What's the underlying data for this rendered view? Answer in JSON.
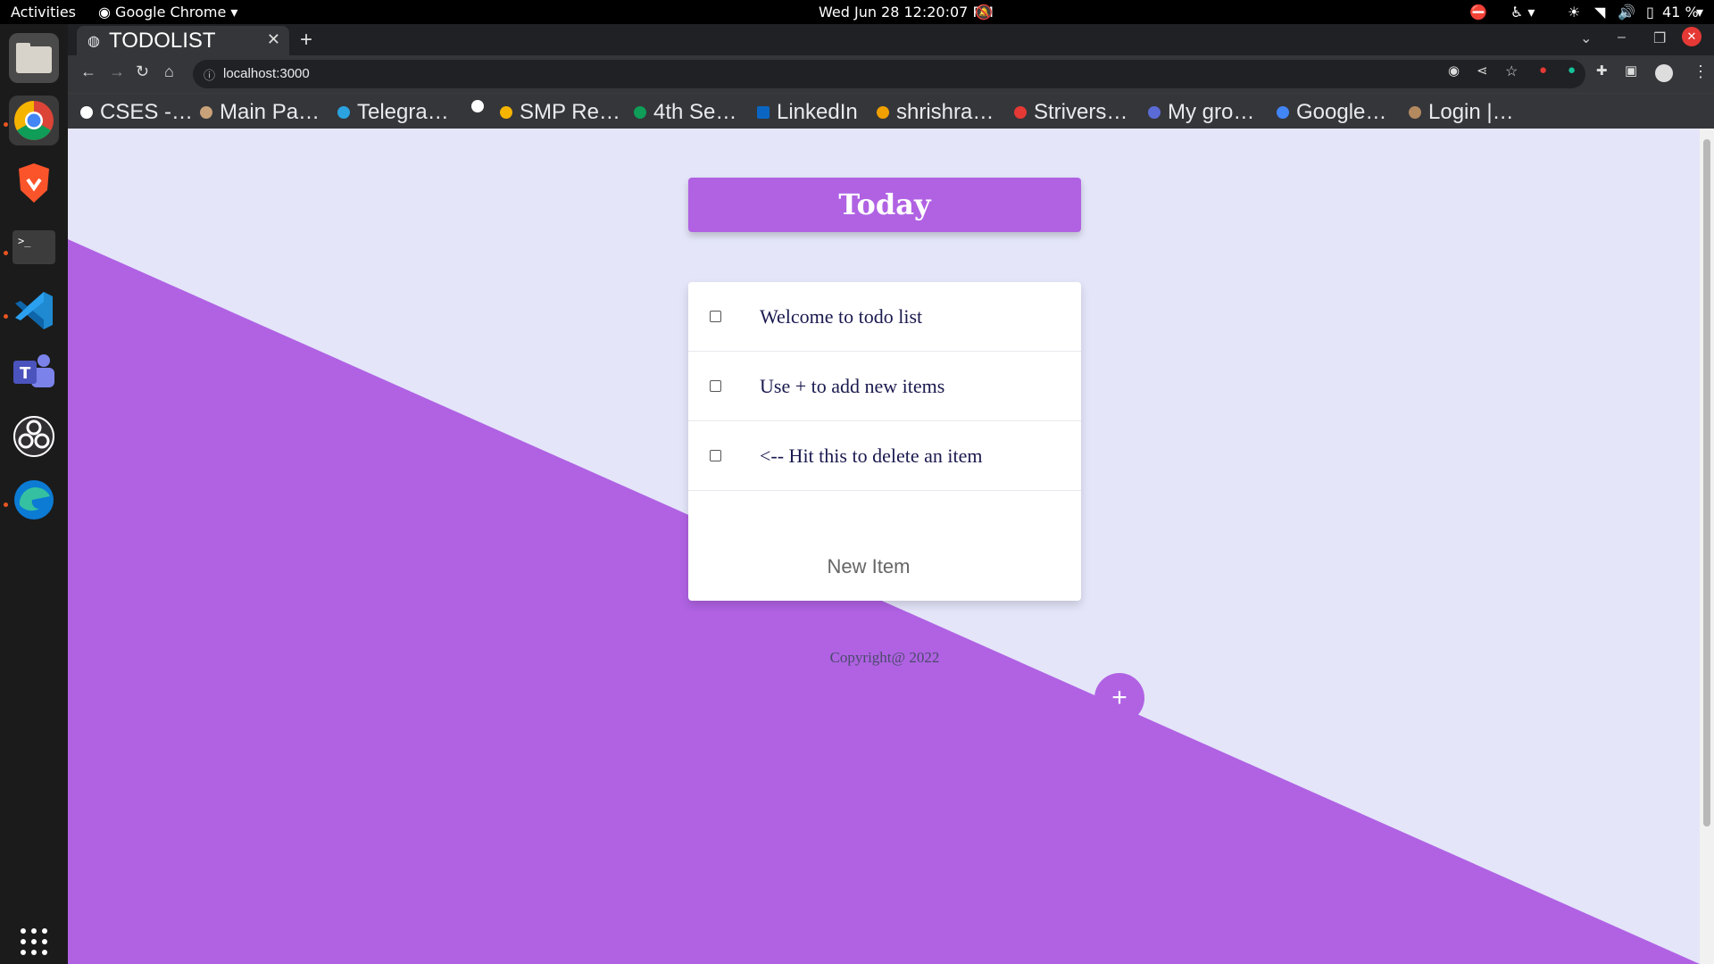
{
  "system": {
    "activities": "Activities",
    "app_name": "Google Chrome",
    "clock": "Wed Jun 28  12:20:07 PM",
    "battery": "41 %"
  },
  "browser": {
    "tab_title": "TODOLIST",
    "url": "localhost:3000",
    "bookmarks": [
      "CSES -…",
      "Main Pa…",
      "Telegra…",
      "SMP Re…",
      "4th Se…",
      "LinkedIn",
      "shrishra…",
      "Strivers…",
      "My gro…",
      "Google…",
      "Login |…"
    ]
  },
  "page": {
    "heading": "Today",
    "items": [
      "Welcome to todo list",
      "Use + to add new items",
      "<-- Hit this to delete an item"
    ],
    "new_item_placeholder": "New Item",
    "add_button": "+",
    "footer": "Copyright@ 2022"
  },
  "colors": {
    "accent": "#b062e3",
    "page_bg": "#e4e5f9"
  }
}
